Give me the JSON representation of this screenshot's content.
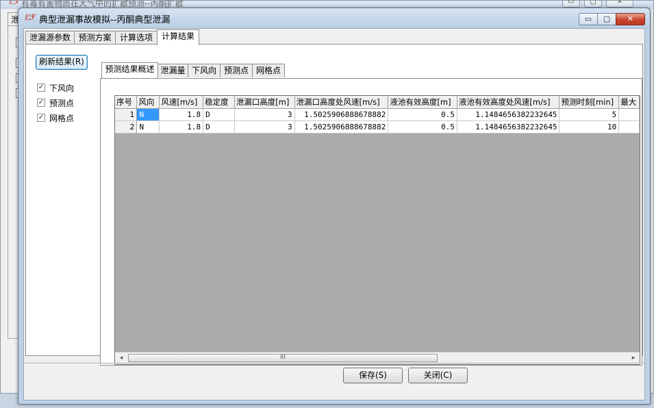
{
  "background_window": {
    "title": "有毒有害物质在大气中的扩散预测--丙酮扩散",
    "tab_fragment": "泄"
  },
  "dialog": {
    "title": "典型泄漏事故模拟--丙酮典型泄漏",
    "min_glyph": "▭",
    "max_glyph": "▢",
    "close_glyph": "✕"
  },
  "top_tabs": [
    {
      "label": "泄漏源参数",
      "active": false
    },
    {
      "label": "预测方案",
      "active": false
    },
    {
      "label": "计算选项",
      "active": false
    },
    {
      "label": "计算结果",
      "active": true
    }
  ],
  "left_panel": {
    "refresh_button": "刷新结果(R)",
    "checkboxes": [
      {
        "label": "下风向",
        "checked": true
      },
      {
        "label": "预测点",
        "checked": true
      },
      {
        "label": "网格点",
        "checked": true
      }
    ],
    "check_glyph": "✓"
  },
  "inner_tabs": [
    {
      "label": "预测结果概述",
      "active": true
    },
    {
      "label": "泄漏量",
      "active": false
    },
    {
      "label": "下风向",
      "active": false
    },
    {
      "label": "预测点",
      "active": false
    },
    {
      "label": "网格点",
      "active": false
    }
  ],
  "grid": {
    "columns": [
      "序号",
      "风向",
      "风速[m/s]",
      "稳定度",
      "泄漏口高度[m]",
      "泄漏口高度处风速[m/s]",
      "液池有效高度[m]",
      "液池有效高度处风速[m/s]",
      "预测时刻[min]",
      "最大"
    ],
    "rows": [
      [
        "1",
        "N",
        "1.8",
        "D",
        "3",
        "1.5025906888678882",
        "0.5",
        "1.1484656382232645",
        "5",
        ""
      ],
      [
        "2",
        "N",
        "1.8",
        "D",
        "3",
        "1.5025906888678882",
        "0.5",
        "1.1484656382232645",
        "10",
        ""
      ]
    ],
    "scroll_left": "◂",
    "scroll_right": "▸",
    "scroll_grip": "III"
  },
  "buttons": {
    "save": "保存(S)",
    "close": "关闭(C)"
  }
}
